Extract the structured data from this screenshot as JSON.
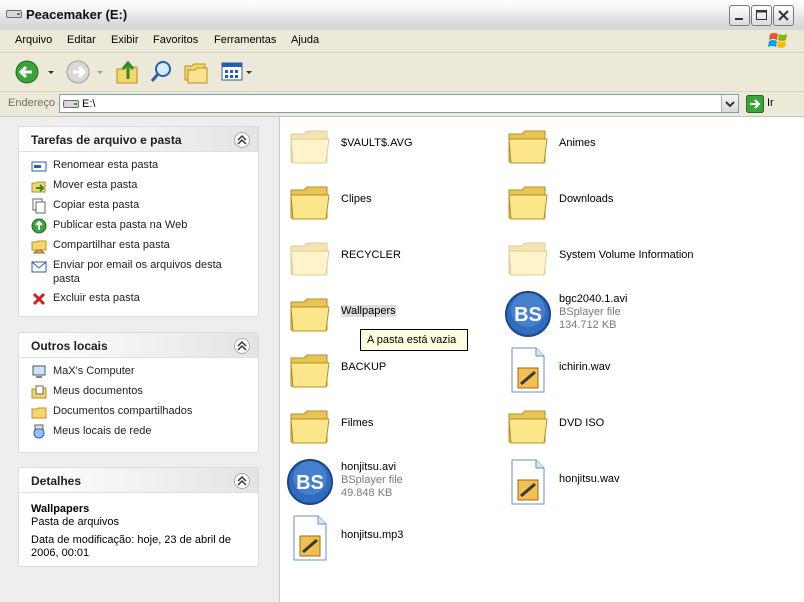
{
  "window": {
    "title": "Peacemaker (E:)"
  },
  "menu": [
    "Arquivo",
    "Editar",
    "Exibir",
    "Favoritos",
    "Ferramentas",
    "Ajuda"
  ],
  "address": {
    "label": "Endereço",
    "value": "E:\\",
    "go_label": "Ir"
  },
  "left": {
    "tasks": {
      "title": "Tarefas de arquivo e pasta",
      "items": [
        {
          "label": "Renomear esta pasta",
          "icon": "rename-icon"
        },
        {
          "label": "Mover esta pasta",
          "icon": "move-folder-icon"
        },
        {
          "label": "Copiar esta pasta",
          "icon": "copy-icon"
        },
        {
          "label": "Publicar esta pasta na Web",
          "icon": "publish-web-icon"
        },
        {
          "label": "Compartilhar esta pasta",
          "icon": "share-folder-icon"
        },
        {
          "label": "Enviar por email os arquivos desta pasta",
          "icon": "email-icon"
        },
        {
          "label": "Excluir esta pasta",
          "icon": "delete-icon"
        }
      ]
    },
    "places": {
      "title": "Outros locais",
      "items": [
        {
          "label": "MaX's Computer",
          "icon": "computer-icon"
        },
        {
          "label": "Meus documentos",
          "icon": "my-documents-icon"
        },
        {
          "label": "Documentos compartilhados",
          "icon": "shared-documents-icon"
        },
        {
          "label": "Meus locais de rede",
          "icon": "network-places-icon"
        }
      ]
    },
    "details": {
      "title": "Detalhes",
      "name": "Wallpapers",
      "type": "Pasta de arquivos",
      "modified": "Data de modificação: hoje, 23 de abril de 2006, 00:01"
    }
  },
  "files": [
    {
      "name": "$VAULT$.AVG",
      "icon": "folder-icon",
      "faded": true
    },
    {
      "name": "Animes",
      "icon": "folder-icon"
    },
    {
      "name": "Clipes",
      "icon": "folder-icon"
    },
    {
      "name": "Downloads",
      "icon": "folder-icon"
    },
    {
      "name": "RECYCLER",
      "icon": "folder-icon",
      "faded": true
    },
    {
      "name": "System Volume Information",
      "icon": "folder-icon",
      "faded": true
    },
    {
      "name": "Wallpapers",
      "icon": "folder-icon",
      "selected": true
    },
    {
      "name": "bgc2040.1.avi",
      "icon": "bsplayer-file-icon",
      "type": "BSplayer file",
      "size": "134.712 KB"
    },
    {
      "name": "BACKUP",
      "icon": "folder-icon"
    },
    {
      "name": "ichirin.wav",
      "icon": "wav-file-icon"
    },
    {
      "name": "Filmes",
      "icon": "folder-icon"
    },
    {
      "name": "DVD ISO",
      "icon": "folder-icon"
    },
    {
      "name": "honjitsu.avi",
      "icon": "bsplayer-file-icon",
      "type": "BSplayer file",
      "size": "49.848 KB"
    },
    {
      "name": "honjitsu.wav",
      "icon": "wav-file-icon"
    },
    {
      "name": "honjitsu.mp3",
      "icon": "mp3-file-icon"
    }
  ],
  "tooltip": "A pasta está vazia"
}
